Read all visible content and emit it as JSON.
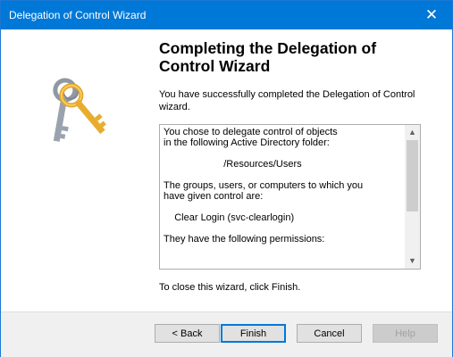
{
  "window": {
    "title": "Delegation of Control Wizard",
    "close_glyph": "✕"
  },
  "heading": "Completing the Delegation of Control Wizard",
  "intro": "You have successfully completed the Delegation of Control wizard.",
  "summary_text": "You chose to delegate control of objects\nin the following Active Directory folder:\n\n                      /Resources/Users\n\nThe groups, users, or computers to which you\nhave given control are:\n\n    Clear Login (svc-clearlogin)\n\nThey have the following permissions:",
  "outro": "To close this wizard, click Finish.",
  "buttons": {
    "back": "< Back",
    "finish": "Finish",
    "cancel": "Cancel",
    "help": "Help"
  },
  "icons": {
    "wizard": "keys-icon",
    "scroll_up": "scroll-up-arrow-icon",
    "scroll_down": "scroll-down-arrow-icon"
  },
  "colors": {
    "titlebar": "#0078d7",
    "accent": "#0078d7"
  }
}
